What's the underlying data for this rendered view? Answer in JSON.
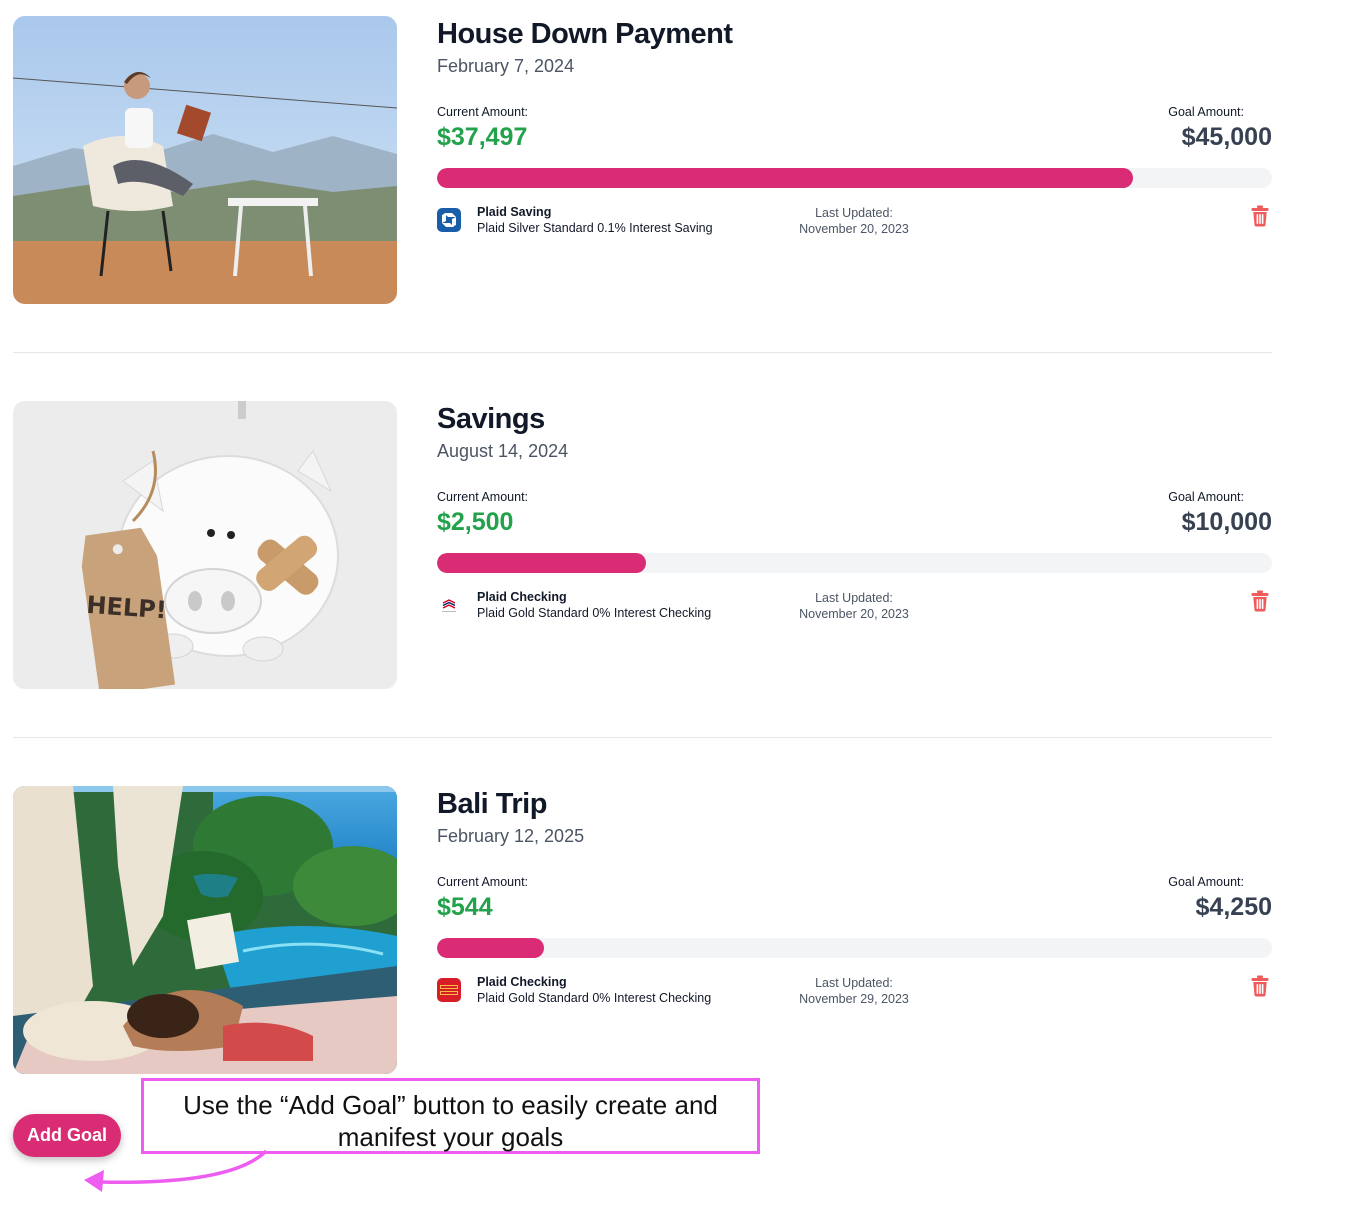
{
  "goals": [
    {
      "title": "House Down Payment",
      "date": "February 7, 2024",
      "current_label": "Current Amount:",
      "current_amount": "$37,497",
      "goal_label": "Goal Amount:",
      "goal_amount": "$45,000",
      "progress_fraction": 0.833,
      "account_name": "Plaid Saving",
      "account_desc": "Plaid Silver Standard 0.1% Interest Saving",
      "updated_label": "Last Updated:",
      "updated_date": "November 20, 2023",
      "bank_icon": "chase-bank-icon",
      "image": "woman-reading-on-terrace-photo"
    },
    {
      "title": "Savings",
      "date": "August 14, 2024",
      "current_label": "Current Amount:",
      "current_amount": "$2,500",
      "goal_label": "Goal Amount:",
      "goal_amount": "$10,000",
      "progress_fraction": 0.25,
      "account_name": "Plaid Checking",
      "account_desc": "Plaid Gold Standard 0% Interest Checking",
      "updated_label": "Last Updated:",
      "updated_date": "November 20, 2023",
      "bank_icon": "bank-of-america-icon",
      "image": "piggy-bank-help-tag-photo"
    },
    {
      "title": "Bali Trip",
      "date": "February 12, 2025",
      "current_label": "Current Amount:",
      "current_amount": "$544",
      "goal_label": "Goal Amount:",
      "goal_amount": "$4,250",
      "progress_fraction": 0.128,
      "account_name": "Plaid Checking",
      "account_desc": "Plaid Gold Standard 0% Interest Checking",
      "updated_label": "Last Updated:",
      "updated_date": "November 29, 2023",
      "bank_icon": "wells-fargo-icon",
      "image": "woman-reading-by-pool-photo"
    }
  ],
  "add_goal_label": "Add Goal",
  "callout_text": "Use the “Add Goal” button to easily create and manifest your goals",
  "photo_text": {
    "help_tag": "HELP!"
  },
  "colors": {
    "accent": "#da2c74",
    "positive": "#22a24b",
    "track": "#f3f4f6",
    "trash": "#ef5b5b",
    "callout_border": "#ee5df0"
  }
}
